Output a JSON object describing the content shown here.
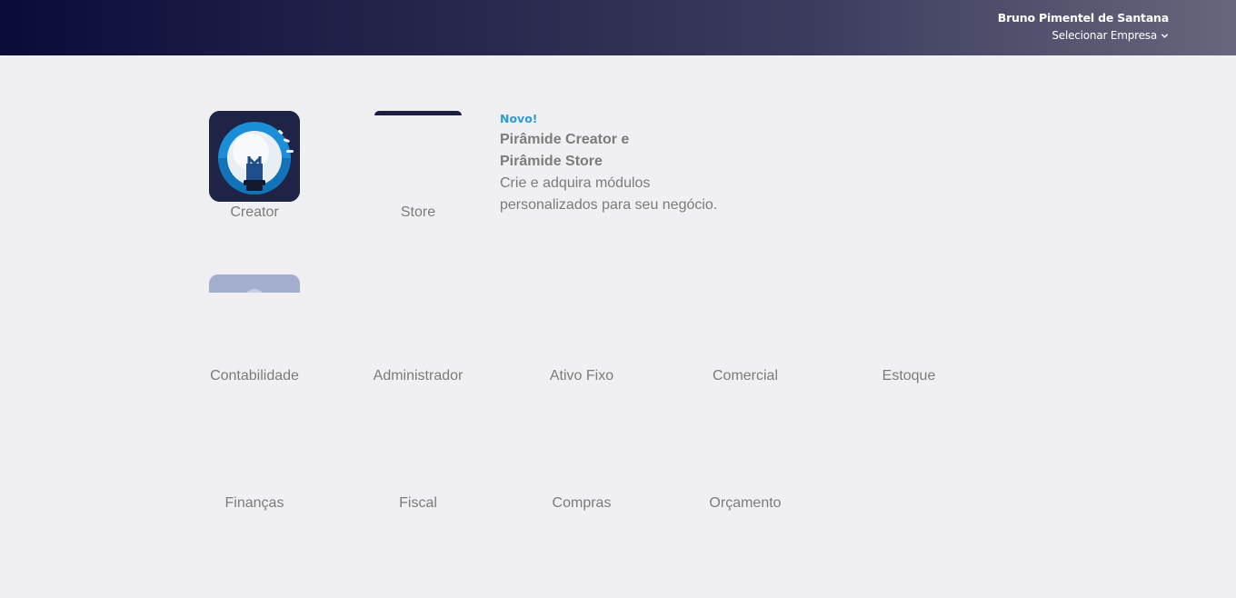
{
  "header": {
    "user_name": "Bruno Pimentel de Santana",
    "company_select_label": "Selecionar Empresa"
  },
  "featured_tiles": [
    {
      "label": "Creator",
      "icon": "lightbulb-icon"
    },
    {
      "label": "Store",
      "icon": "store-icon"
    }
  ],
  "promo": {
    "badge": "Novo!",
    "title_line1": "Pirâmide Creator e",
    "title_line2": "Pirâmide Store",
    "desc_line1": "Crie e adquira módulos",
    "desc_line2": "personalizados para seu negócio."
  },
  "modules_row1": [
    {
      "label": "Contabilidade",
      "icon": "contabilidade-icon"
    },
    {
      "label": "Administrador",
      "icon": "administrador-icon"
    },
    {
      "label": "Ativo Fixo",
      "icon": "ativo-fixo-icon"
    },
    {
      "label": "Comercial",
      "icon": "comercial-icon"
    },
    {
      "label": "Estoque",
      "icon": "estoque-icon"
    }
  ],
  "modules_row2": [
    {
      "label": "Finanças",
      "icon": "financas-icon"
    },
    {
      "label": "Fiscal",
      "icon": "fiscal-icon"
    },
    {
      "label": "Compras",
      "icon": "compras-icon"
    },
    {
      "label": "Orçamento",
      "icon": "orcamento-icon"
    }
  ],
  "colors": {
    "header_gradient_start": "#0b0b3a",
    "header_gradient_end": "#66667c",
    "page_background": "#f0f0f2",
    "badge_accent": "#2d9cd6",
    "label_text": "#7b7b7b"
  }
}
